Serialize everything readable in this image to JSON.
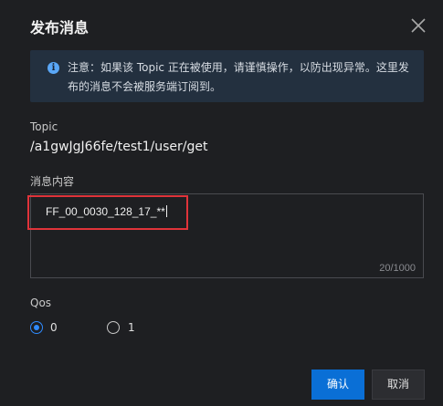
{
  "dialog": {
    "title": "发布消息",
    "notice": "注意：如果该 Topic 正在被使用，请谨慎操作，以防出现异常。这里发布的消息不会被服务端订阅到。",
    "topic_label": "Topic",
    "topic_value": "/a1gwJgJ66fe/test1/user/get",
    "content_label": "消息内容",
    "content_value": "FF_00_0030_128_17_**",
    "content_counter": "20/1000",
    "qos_label": "Qos",
    "qos_options": [
      {
        "label": "0",
        "selected": true
      },
      {
        "label": "1",
        "selected": false
      }
    ],
    "confirm_label": "确认",
    "cancel_label": "取消"
  },
  "colors": {
    "primary": "#0a6fd6",
    "highlight": "#e0333a",
    "info": "#5aa7f7"
  }
}
